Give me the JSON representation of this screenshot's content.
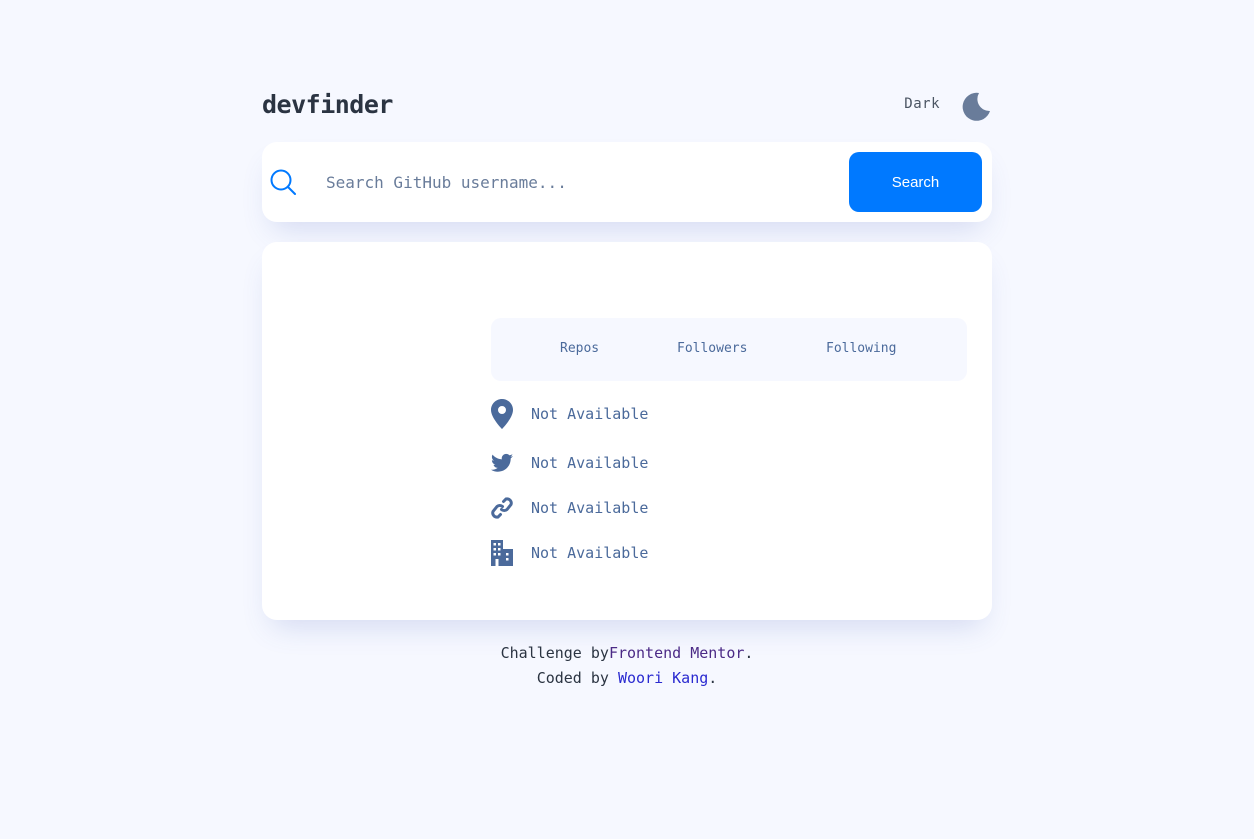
{
  "header": {
    "logo": "devfinder",
    "theme_label": "Dark",
    "theme_icon": "moon-icon"
  },
  "search": {
    "placeholder": "Search GitHub username...",
    "value": "",
    "button_label": "Search",
    "icon": "search-icon"
  },
  "card": {
    "stats": [
      {
        "label": "Repos"
      },
      {
        "label": "Followers"
      },
      {
        "label": "Following"
      }
    ],
    "info": [
      {
        "icon": "location-pin-icon",
        "text": "Not Available"
      },
      {
        "icon": "twitter-icon",
        "text": "Not Available"
      },
      {
        "icon": "link-icon",
        "text": "Not Available"
      },
      {
        "icon": "building-icon",
        "text": "Not Available"
      }
    ]
  },
  "footer": {
    "line1_prefix": "Challenge by",
    "line1_link": "Frontend Mentor",
    "line1_suffix": ".",
    "line2_prefix": "Coded by ",
    "line2_link": "Woori Kang",
    "line2_suffix": "."
  },
  "colors": {
    "background": "#f6f8ff",
    "accent": "#0079ff",
    "icon": "#4b6a9b",
    "card": "#ffffff"
  }
}
